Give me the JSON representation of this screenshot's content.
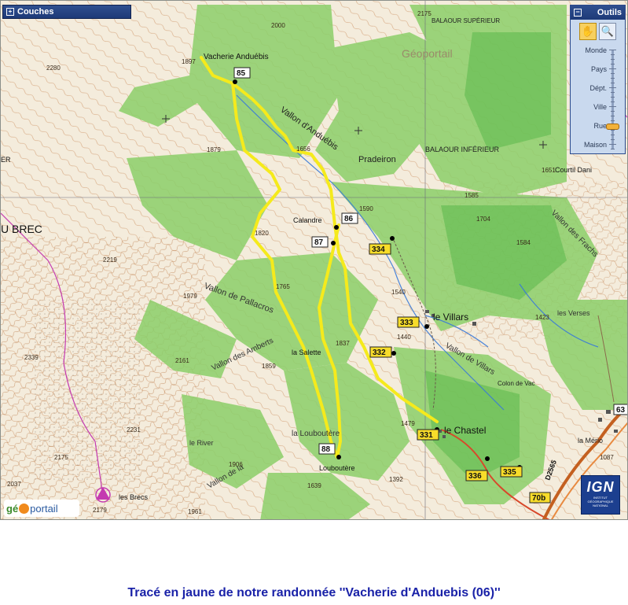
{
  "layers_panel": {
    "title": "Couches",
    "toggle": "+"
  },
  "tools_panel": {
    "title": "Outils",
    "toggle": "−",
    "tools": [
      {
        "name": "pan",
        "icon": "hand-icon",
        "active": true
      },
      {
        "name": "zoom",
        "icon": "magnifier-icon",
        "active": false
      }
    ],
    "zoom_levels": [
      "Monde",
      "Pays",
      "Dépt.",
      "Ville",
      "Rue",
      "Maison"
    ],
    "current_zoom": "Rue"
  },
  "map": {
    "place_labels": [
      "Vacherie Anduébis",
      "Vallon d'Anduébis",
      "Pradeiron",
      "BALAOUR INFÉRIEUR",
      "BALAOUR SUPÉRIEUR",
      "Courtil Dani",
      "Calandre",
      "le Villars",
      "Colon de Vac",
      "Vallon de Pallacros",
      "Vallon des Amberts",
      "la Salette",
      "la Louboutère",
      "Louboutère",
      "le River",
      "Vallon de la",
      "le Chastel",
      "les Brecs",
      "U BREC",
      "ER",
      "Vallon des Frachs",
      "Vallon de Villars",
      "les Verses",
      "la Mério",
      "Géoportail"
    ],
    "elevations": [
      "2000",
      "2175",
      "2280",
      "1897",
      "1879",
      "1656",
      "1651",
      "1585",
      "1704",
      "1584",
      "1590",
      "1820",
      "1765",
      "1837",
      "1859",
      "2219",
      "1979",
      "2161",
      "2339",
      "2231",
      "2175",
      "2037",
      "2179",
      "1961",
      "1639",
      "1392",
      "1479",
      "1423",
      "1540",
      "1440",
      "1087",
      "1906"
    ],
    "waypoints": [
      "85",
      "86",
      "87",
      "88",
      "331",
      "332",
      "333",
      "334",
      "335",
      "336",
      "63"
    ],
    "road_labels": [
      "70b",
      "D2565"
    ],
    "track_color": "#f5ea1c"
  },
  "logos": {
    "geoportail": {
      "g": "gé",
      "p": "portail"
    },
    "ign": {
      "text": "IGN",
      "subtitle": "INSTITUT GÉOGRAPHIQUE NATIONAL"
    }
  },
  "caption": "Tracé en jaune de notre randonnée ''Vacherie d'Anduebis (06)''"
}
